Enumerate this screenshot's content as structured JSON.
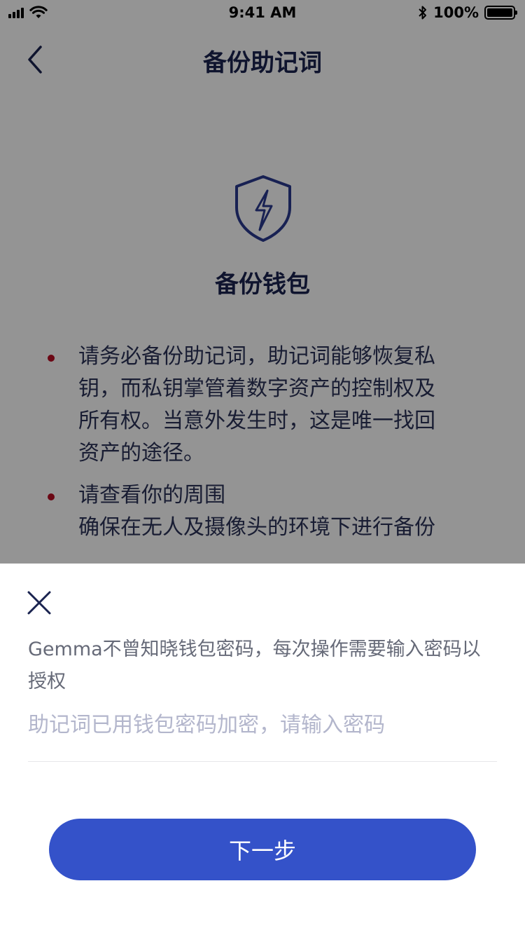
{
  "status_bar": {
    "time": "9:41 AM",
    "battery": "100%"
  },
  "nav": {
    "title": "备份助记词",
    "back_icon": "chevron-left-icon"
  },
  "content": {
    "icon": "shield-lightning-icon",
    "title": "备份钱包",
    "bullets": [
      {
        "lines": [
          "请务必备份助记词，助记词能够恢复私",
          "钥，而私钥掌管着数字资产的控制权及",
          "所有权。当意外发生时，这是唯一找回",
          "资产的途径。"
        ]
      },
      {
        "lines": [
          "请查看你的周围",
          "确保在无人及摄像头的环境下进行备份"
        ]
      }
    ],
    "bullet_color": "#b80d24"
  },
  "sheet": {
    "close_icon": "close-icon",
    "notice": "Gemma不曾知晓钱包密码，每次操作需要输入密码以授权",
    "password_placeholder": "助记词已用钱包密码加密，请输入密码",
    "next_label": "下一步"
  },
  "colors": {
    "primary": "#3452c9",
    "title": "#1a2350",
    "bullet": "#b80d24"
  }
}
